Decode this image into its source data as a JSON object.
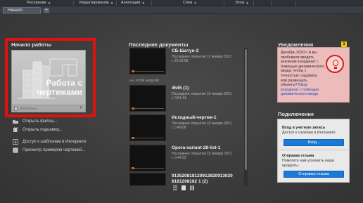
{
  "ribbon_panels": [
    {
      "label": "Рисование"
    },
    {
      "label": "Редактирование"
    },
    {
      "label": "Аннотации"
    },
    {
      "label": "Слои"
    },
    {
      "label": "Блок"
    }
  ],
  "tabs": {
    "start_label": "Начало",
    "add_label": "+"
  },
  "start": {
    "heading": "Начало работы",
    "card_title_line1": "Работа с",
    "card_title_line2": "чертежами",
    "templates_label": "Шаблоны",
    "actions": [
      {
        "label": "Открыть файлы...",
        "icon": "folder-icon"
      },
      {
        "label": "Открыть подшивку...",
        "icon": "sheet-set-icon"
      },
      {
        "label": "Доступ к шаблонам в Интернете",
        "icon": "template-download-icon"
      },
      {
        "label": "Просмотр примеров чертежей...",
        "icon": "sample-drawings-icon"
      }
    ]
  },
  "recent": {
    "heading": "Последние документы",
    "week_label": "НА ЭТОЙ НЕДЕЛЕ",
    "docs": [
      {
        "name": "СБ-Шатун-2",
        "meta1": "Последнее открытие 11 января 2021",
        "meta2": "г. 20:29:58"
      },
      {
        "name": "4545 (1)",
        "meta1": "Последнее открытие 10 января 2021",
        "meta2": "г. 0:51:41"
      },
      {
        "name": "Исходный-чертеж-1",
        "meta1": "Последнее открытие 10 января 2021",
        "meta2": "г. 0:49:06"
      },
      {
        "name": "Opora-variant-28-list-1",
        "meta1": "Последнее открытие 10 января 2021",
        "meta2": "г. 0:44:23"
      },
      {
        "name": "913520818120912820913020 8181208182 1 (2)",
        "meta1": "",
        "meta2": ""
      }
    ]
  },
  "notifications": {
    "heading": "Уведомления",
    "badge": "1",
    "text": "Декабрь 2020 г. А вы пробовали вводить значение координат с помощью динамического ввода, чтобы с точностью создавать или размещать объекты?",
    "link": "Ввод координат с помощью динамического ввода"
  },
  "connection": {
    "heading": "Подключение",
    "signin_title": "Вход в учетную запись",
    "signin_text": "Доступ к службам в Интернете",
    "signin_button": "Вход...",
    "feedback_title": "Отправка отзыва",
    "feedback_text": "Помогите нам улучшить наши продукты",
    "feedback_button": "Отправка отзыва"
  },
  "colors": {
    "highlight": "#e31010",
    "accent": "#1b7ad6",
    "notification_bg": "#ecbcbc",
    "badge": "#f2c40b"
  }
}
